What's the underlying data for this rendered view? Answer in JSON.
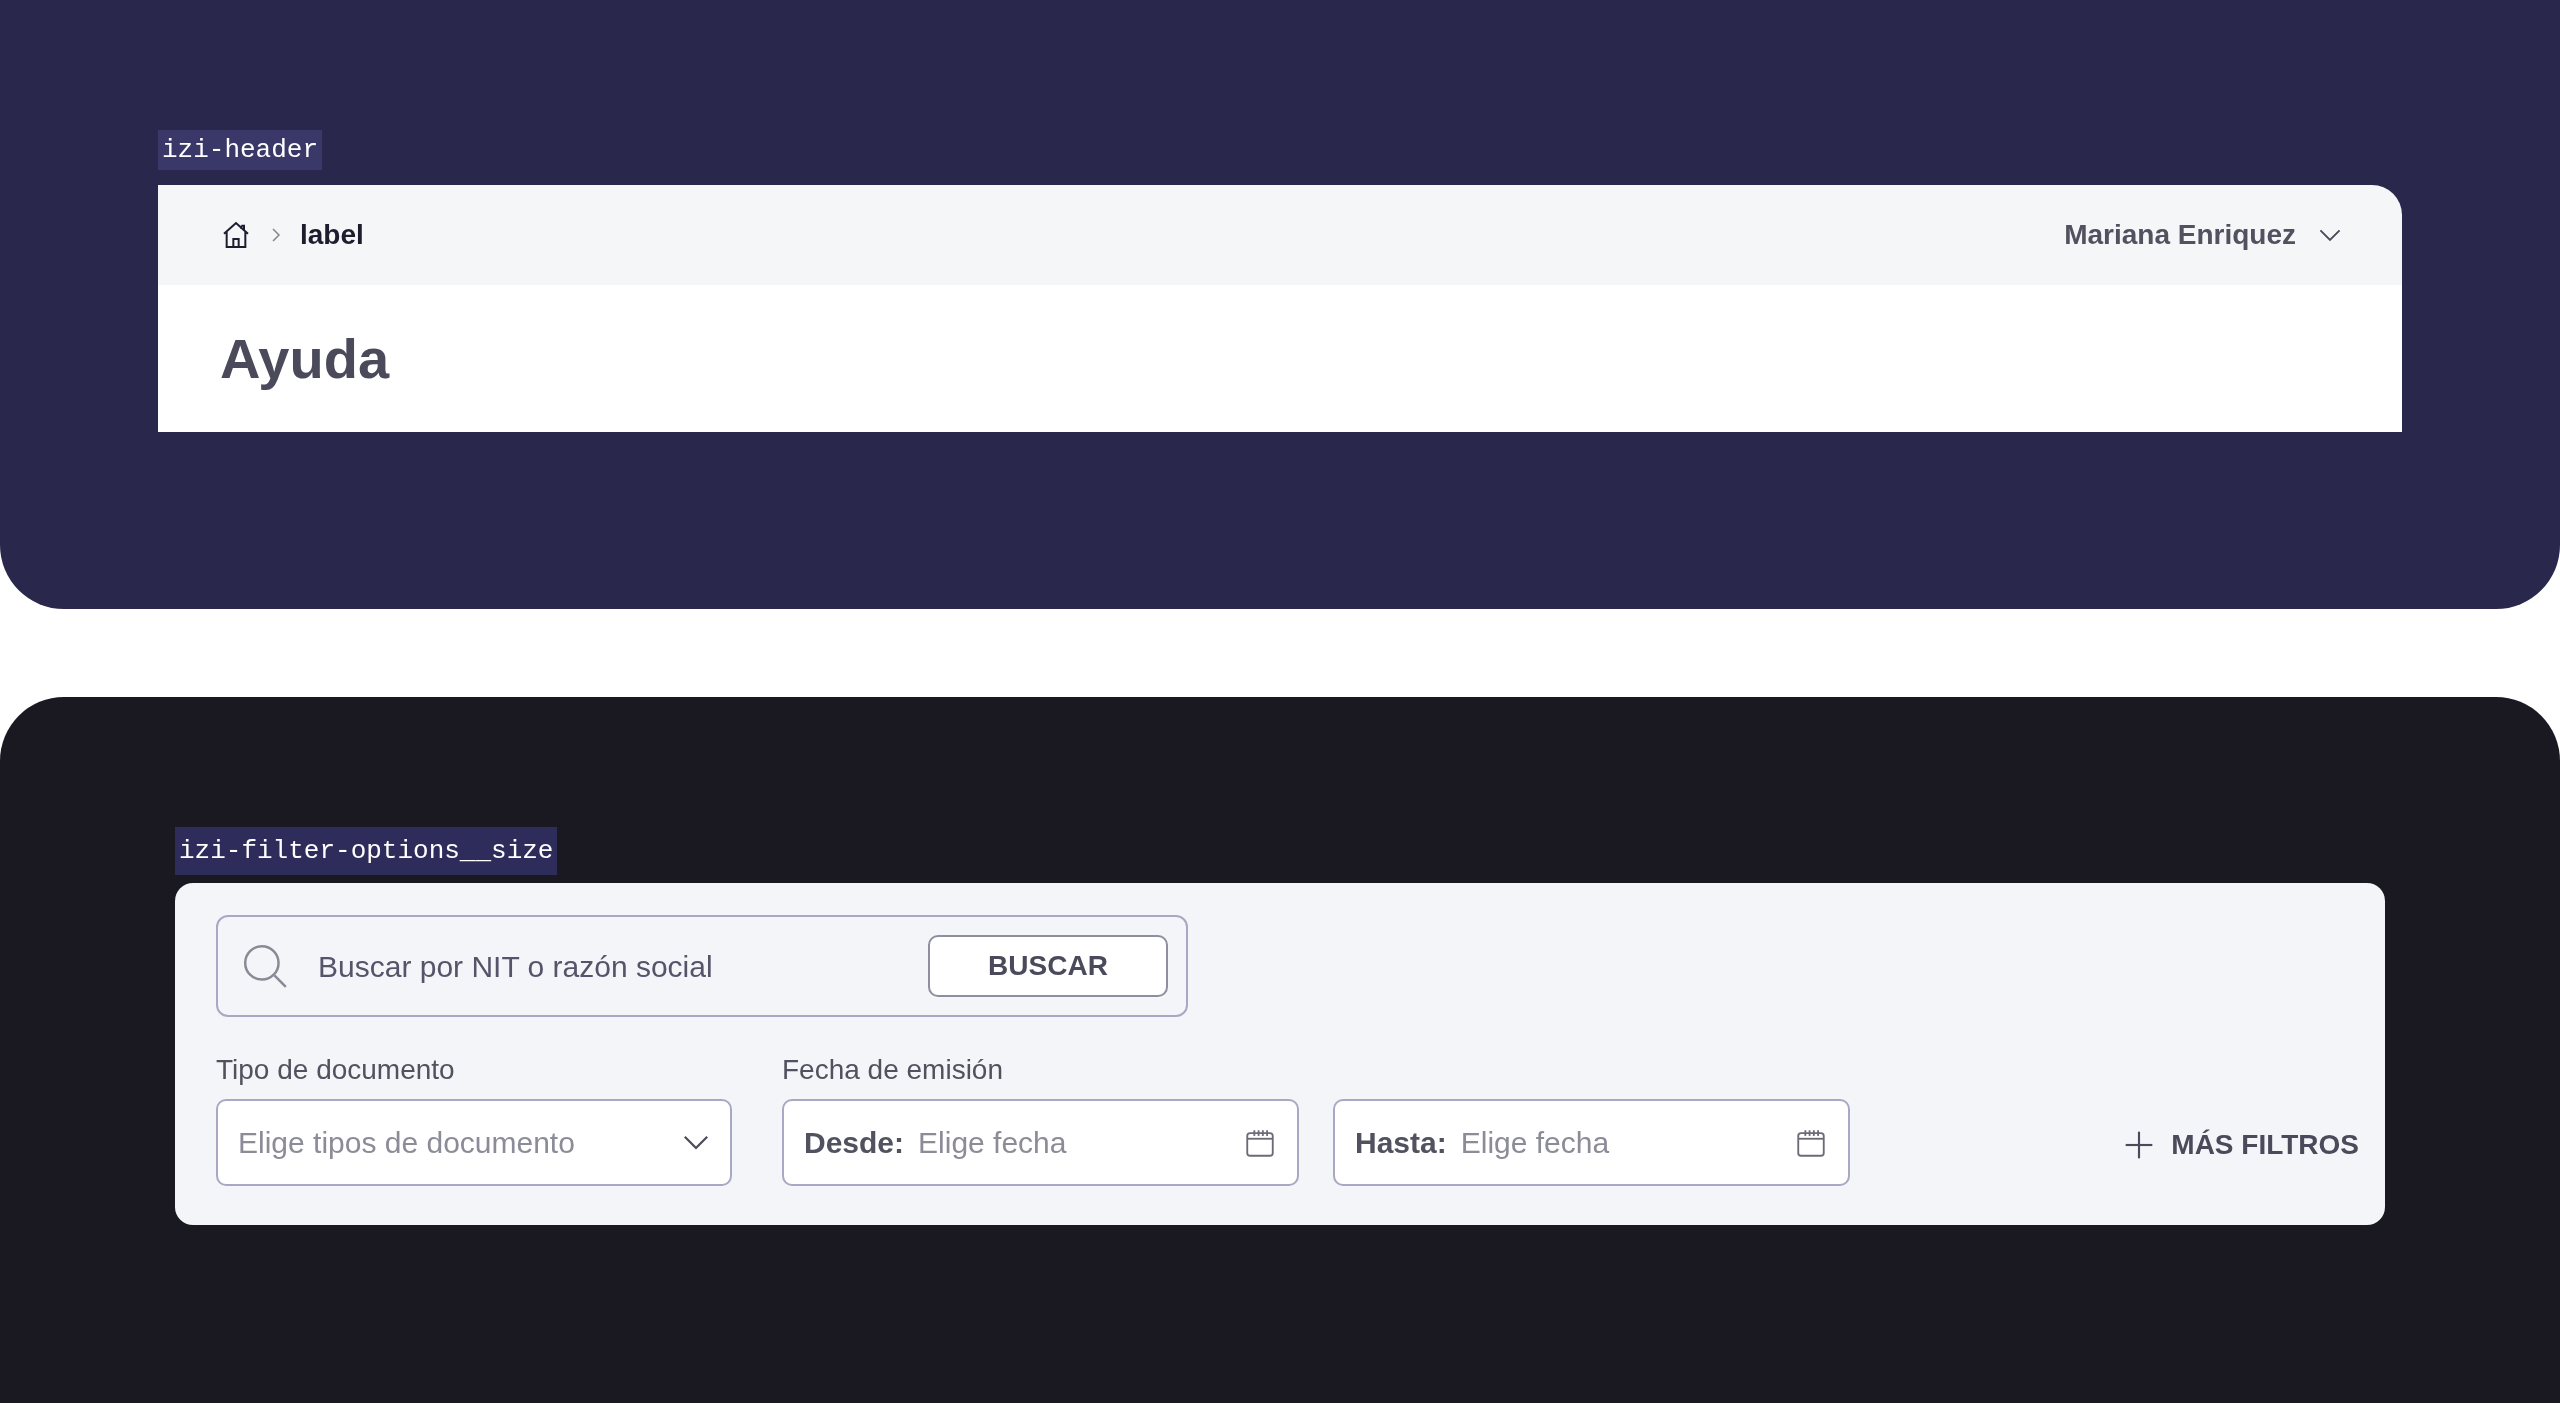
{
  "header_section": {
    "tag": "izi-header",
    "breadcrumb": {
      "current": "label"
    },
    "user": {
      "name": "Mariana Enriquez"
    },
    "title": "Ayuda"
  },
  "filter_section": {
    "tag": "izi-filter-options__size",
    "search": {
      "placeholder": "Buscar por NIT o razón social",
      "button": "BUSCAR"
    },
    "document_type": {
      "label": "Tipo de documento",
      "placeholder": "Elige tipos de documento"
    },
    "issue_date": {
      "label": "Fecha de emisión",
      "fields": [
        {
          "prefix": "Desde:",
          "placeholder": "Elige fecha"
        },
        {
          "prefix": "Hasta:",
          "placeholder": "Elige fecha"
        }
      ]
    },
    "more_filters": "MÁS FILTROS"
  }
}
